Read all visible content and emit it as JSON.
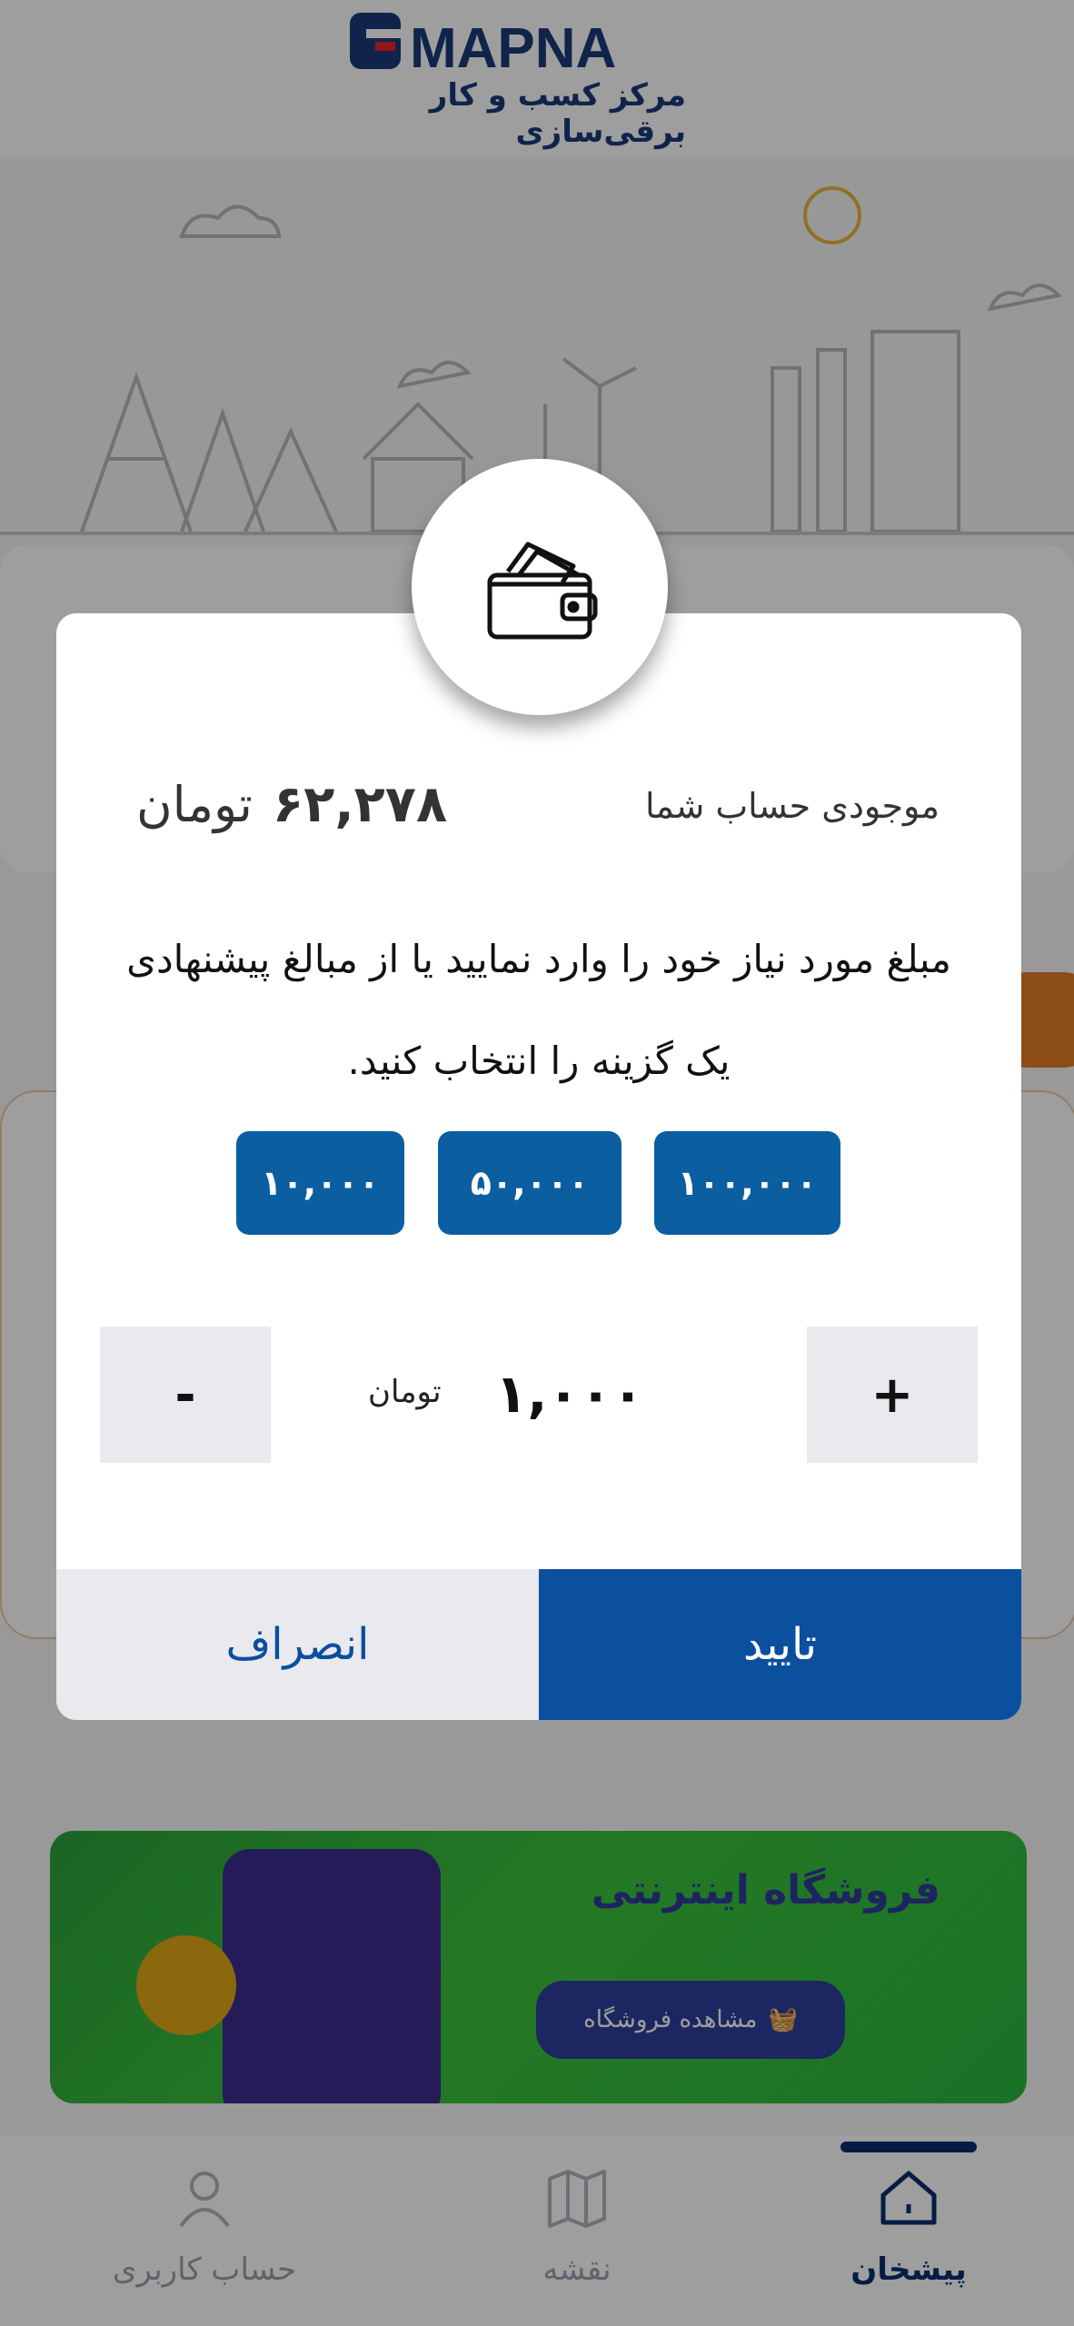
{
  "brand": {
    "name": "MAPNA",
    "subtitle": "مرکز کسب و کار برقی‌سازی"
  },
  "promo": {
    "title": "فروشگاه اینترنتی",
    "button": "مشاهده فروشگاه"
  },
  "bottom_nav": [
    {
      "label": "پیشخان",
      "icon": "home-icon",
      "active": true
    },
    {
      "label": "نقشه",
      "icon": "map-icon",
      "active": false
    },
    {
      "label": "حساب کاربری",
      "icon": "user-icon",
      "active": false
    }
  ],
  "dialog": {
    "icon": "wallet-icon",
    "balance_label": "موجودی حساب شما",
    "balance_value": "۶۲,۲۷۸",
    "currency": "تومان",
    "instruction": "مبلغ مورد نیاز خود را وارد نمایید یا از مبالغ پیشنهادی یک گزینه را انتخاب کنید.",
    "chips": [
      "۱۰۰,۰۰۰",
      "۵۰,۰۰۰",
      "۱۰,۰۰۰"
    ],
    "stepper": {
      "plus": "+",
      "minus": "-",
      "amount": "۱,۰۰۰",
      "unit": "تومان"
    },
    "confirm": "تایید",
    "cancel": "انصراف"
  },
  "colors": {
    "primary": "#0b4f9f",
    "chip": "#0b5fa0",
    "nav_active": "#0a2e6f"
  }
}
